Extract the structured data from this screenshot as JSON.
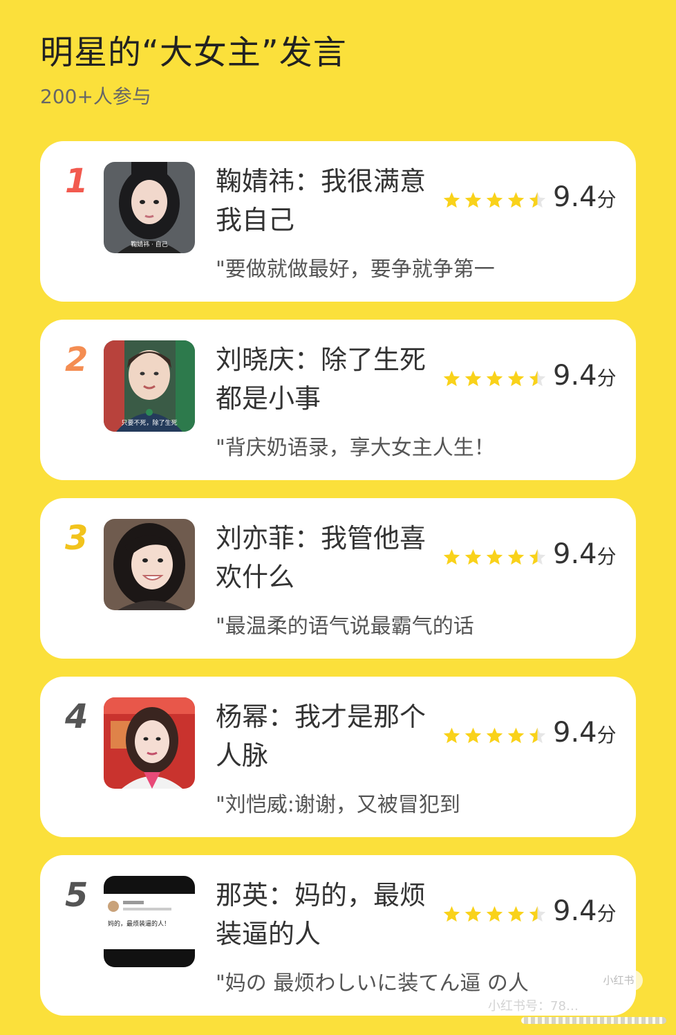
{
  "header": {
    "title": "明星的“大女主”发言",
    "participants": "200+人参与"
  },
  "colors": {
    "background": "#fbe03b",
    "star": "#f9d21a",
    "rank1": "#f25a4f",
    "rank2": "#f48d52",
    "rank3": "#f2c31c",
    "rank_other": "#555555"
  },
  "items": [
    {
      "rank": "1",
      "name": "鞠婧祎：我很满意我自己",
      "quote": "\"要做就做最好，要争就争第一",
      "score": "9.4",
      "unit": "分",
      "rating": 4.5,
      "avatar": "portrait-dark-hair",
      "avatar_caption": "鞠婧祎 · 自己"
    },
    {
      "rank": "2",
      "name": "刘晓庆：除了生死都是小事",
      "quote": "\"背庆奶语录，享大女主人生！",
      "score": "9.4",
      "unit": "分",
      "rating": 4.5,
      "avatar": "portrait-interview",
      "avatar_caption": "只要不死，除了生死"
    },
    {
      "rank": "3",
      "name": "刘亦菲：我管他喜欢什么",
      "quote": "\"最温柔的语气说最霸气的话",
      "score": "9.4",
      "unit": "分",
      "rating": 4.5,
      "avatar": "portrait-smiling",
      "avatar_caption": ""
    },
    {
      "rank": "4",
      "name": "杨幂：我才是那个人脉",
      "quote": "\"刘恺威:谢谢，又被冒犯到",
      "score": "9.4",
      "unit": "分",
      "rating": 4.5,
      "avatar": "portrait-red-background",
      "avatar_caption": ""
    },
    {
      "rank": "5",
      "name": "那英：妈的，最烦装逼的人",
      "quote": "\"妈の 最烦わしいに装てん逼 の人",
      "score": "9.4",
      "unit": "分",
      "rating": 4.5,
      "avatar": "social-post-screenshot",
      "avatar_caption": "妈的，最烦装逼的人！"
    }
  ],
  "watermark": {
    "logo": "小红书",
    "user": "小红书号：78…"
  }
}
